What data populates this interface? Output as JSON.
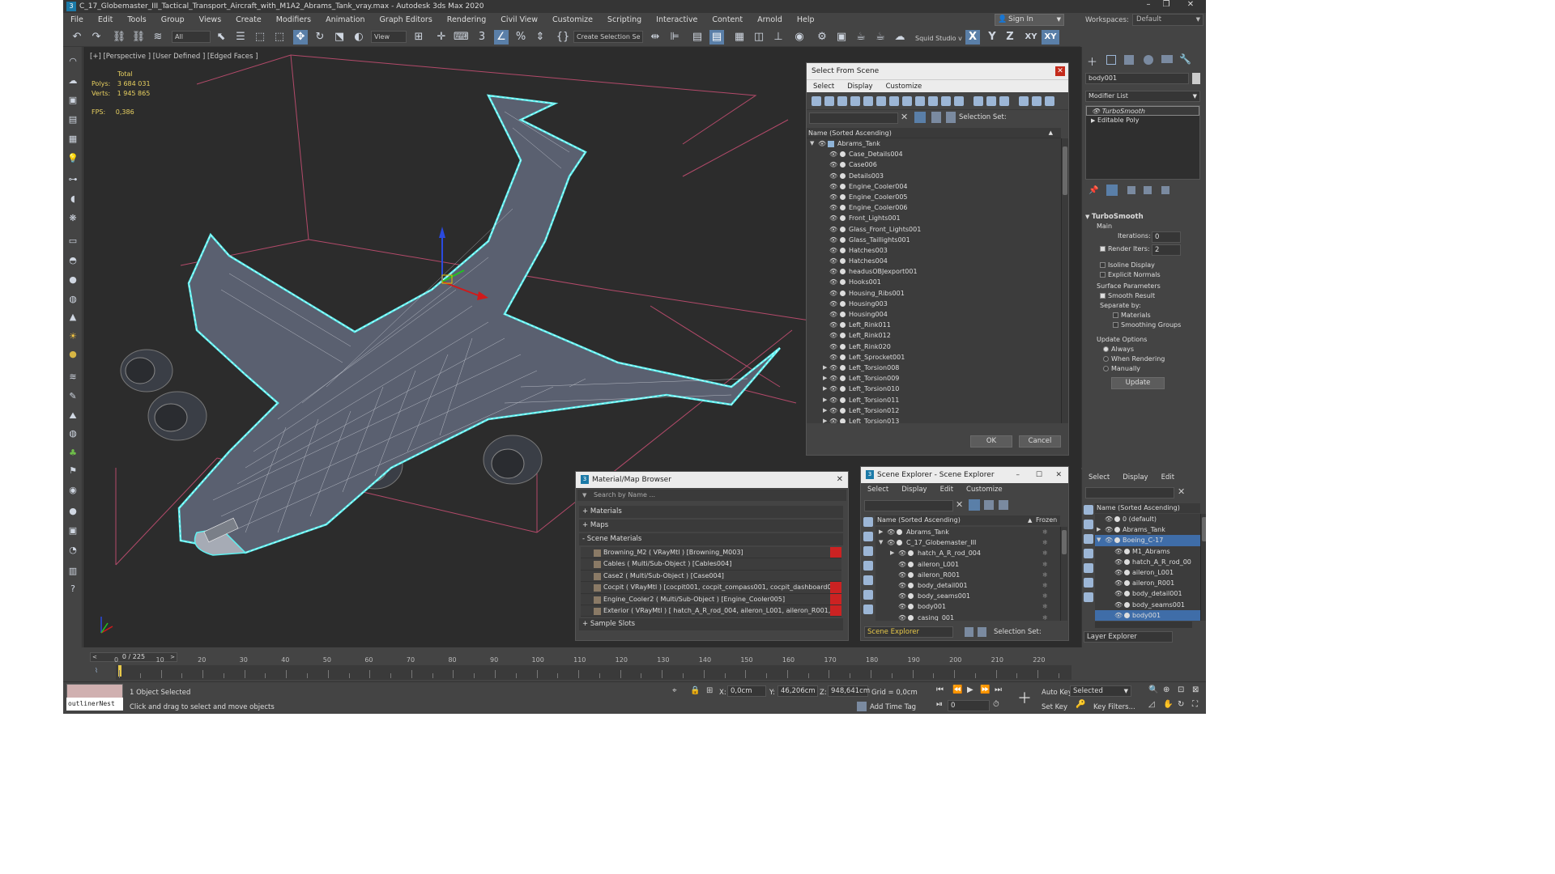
{
  "window": {
    "title": "C_17_Globemaster_III_Tactical_Transport_Aircraft_with_M1A2_Abrams_Tank_vray.max - Autodesk 3ds Max 2020",
    "controls": [
      "–",
      "❐",
      "✕"
    ]
  },
  "menu": [
    "File",
    "Edit",
    "Tools",
    "Group",
    "Views",
    "Create",
    "Modifiers",
    "Animation",
    "Graph Editors",
    "Rendering",
    "Civil View",
    "Customize",
    "Scripting",
    "Interactive",
    "Content",
    "Arnold",
    "Help"
  ],
  "account": {
    "sign_in": "Sign In",
    "workspaces_label": "Workspaces:",
    "workspace": "Default"
  },
  "toolbar": {
    "filter_select": "All",
    "ref_coord": "View",
    "selection_set": "Create Selection Se",
    "project": "Squid Studio v",
    "axes": [
      "X",
      "Y",
      "Z",
      "XY",
      "XY"
    ]
  },
  "viewport": {
    "label": "[+] [Perspective ] [User Defined ] [Edged Faces ]",
    "stats_total": "Total",
    "polys_label": "Polys:",
    "polys": "3 684 031",
    "verts_label": "Verts:",
    "verts": "1 945 865",
    "fps_label": "FPS:",
    "fps": "0,386"
  },
  "select_from_scene": {
    "title": "Select From Scene",
    "menu": [
      "Select",
      "Display",
      "Customize"
    ],
    "selection_set_label": "Selection Set:",
    "column_header": "Name (Sorted Ascending)",
    "root": "Abrams_Tank",
    "items": [
      {
        "name": "Case_Details004",
        "expand": false
      },
      {
        "name": "Case006",
        "expand": false
      },
      {
        "name": "Details003",
        "expand": false
      },
      {
        "name": "Engine_Cooler004",
        "expand": false
      },
      {
        "name": "Engine_Cooler005",
        "expand": false
      },
      {
        "name": "Engine_Cooler006",
        "expand": false
      },
      {
        "name": "Front_Lights001",
        "expand": false
      },
      {
        "name": "Glass_Front_Lights001",
        "expand": false
      },
      {
        "name": "Glass_Taillights001",
        "expand": false
      },
      {
        "name": "Hatches003",
        "expand": false
      },
      {
        "name": "Hatches004",
        "expand": false
      },
      {
        "name": "headusOBJexport001",
        "expand": false
      },
      {
        "name": "Hooks001",
        "expand": false
      },
      {
        "name": "Housing_Ribs001",
        "expand": false
      },
      {
        "name": "Housing003",
        "expand": false
      },
      {
        "name": "Housing004",
        "expand": false
      },
      {
        "name": "Left_Rink011",
        "expand": false
      },
      {
        "name": "Left_Rink012",
        "expand": false
      },
      {
        "name": "Left_Rink020",
        "expand": false
      },
      {
        "name": "Left_Sprocket001",
        "expand": false
      },
      {
        "name": "Left_Torsion008",
        "expand": true
      },
      {
        "name": "Left_Torsion009",
        "expand": true
      },
      {
        "name": "Left_Torsion010",
        "expand": true
      },
      {
        "name": "Left_Torsion011",
        "expand": true
      },
      {
        "name": "Left_Torsion012",
        "expand": true
      },
      {
        "name": "Left_Torsion013",
        "expand": true
      }
    ],
    "ok": "OK",
    "cancel": "Cancel"
  },
  "material_browser": {
    "title": "Material/Map Browser",
    "search_placeholder": "Search by Name ...",
    "materials": "+ Materials",
    "maps": "+ Maps",
    "scene_materials": "- Scene Materials",
    "entries": [
      "Browning_M2  ( VRayMtl ) [Browning_M003]",
      "Cables  ( Multi/Sub-Object ) [Cables004]",
      "Case2  ( Multi/Sub-Object ) [Case004]",
      "Cocpit  ( VRayMtl ) [cocpit001, cocpit_compass001, cocpit_dashboard001, co...",
      "Engine_Cooler2  ( Multi/Sub-Object ) [Engine_Cooler005]",
      "Exterior  ( VRayMtl ) [ hatch_A_R_rod_004, aileron_L001, aileron_R001, bod..."
    ],
    "sample_slots": "+ Sample Slots"
  },
  "scene_explorer": {
    "title": "Scene Explorer - Scene Explorer",
    "menu": [
      "Select",
      "Display",
      "Edit",
      "Customize"
    ],
    "col_name": "Name (Sorted Ascending)",
    "col_frozen": "Frozen",
    "items": [
      {
        "name": "Abrams_Tank",
        "level": 0,
        "arrow": "▶"
      },
      {
        "name": "C_17_Globemaster_III",
        "level": 0,
        "arrow": "▼"
      },
      {
        "name": "hatch_A_R_rod_004",
        "level": 1,
        "arrow": "▶"
      },
      {
        "name": "aileron_L001",
        "level": 1,
        "arrow": ""
      },
      {
        "name": "aileron_R001",
        "level": 1,
        "arrow": ""
      },
      {
        "name": "body_detail001",
        "level": 1,
        "arrow": ""
      },
      {
        "name": "body_seams001",
        "level": 1,
        "arrow": ""
      },
      {
        "name": "body001",
        "level": 1,
        "arrow": ""
      },
      {
        "name": "casing_001",
        "level": 1,
        "arrow": ""
      }
    ],
    "footer_name": "Scene Explorer",
    "selection_set_label": "Selection Set:"
  },
  "command_panel": {
    "object_name": "body001",
    "modifier_list": "Modifier List",
    "stack": [
      "TurboSmooth",
      "Editable Poly"
    ],
    "rollout_title": "TurboSmooth",
    "main": "Main",
    "iterations_label": "Iterations:",
    "iterations": "0",
    "render_iters_label": "Render Iters:",
    "render_iters": "2",
    "isoline": "Isoline Display",
    "explicit_normals": "Explicit Normals",
    "surface_params": "Surface Parameters",
    "smooth_result": "Smooth Result",
    "separate_by": "Separate by:",
    "materials": "Materials",
    "smoothing_groups": "Smoothing Groups",
    "update_options": "Update Options",
    "always": "Always",
    "when_rendering": "When Rendering",
    "manually": "Manually",
    "update": "Update"
  },
  "layer_explorer": {
    "menu": [
      "Select",
      "Display",
      "Edit"
    ],
    "col_name": "Name (Sorted Ascending)",
    "items": [
      {
        "name": "0 (default)",
        "level": 0,
        "arrow": "",
        "selected": false
      },
      {
        "name": "Abrams_Tank",
        "level": 0,
        "arrow": "▶",
        "selected": false
      },
      {
        "name": "Boeing_C-17",
        "level": 0,
        "arrow": "▼",
        "selected": true
      },
      {
        "name": "M1_Abrams",
        "level": 1,
        "arrow": "",
        "selected": false
      },
      {
        "name": "hatch_A_R_rod_00",
        "level": 1,
        "arrow": "",
        "selected": false
      },
      {
        "name": "aileron_L001",
        "level": 1,
        "arrow": "",
        "selected": false
      },
      {
        "name": "aileron_R001",
        "level": 1,
        "arrow": "",
        "selected": false
      },
      {
        "name": "body_detail001",
        "level": 1,
        "arrow": "",
        "selected": false
      },
      {
        "name": "body_seams001",
        "level": 1,
        "arrow": "",
        "selected": false
      },
      {
        "name": "body001",
        "level": 1,
        "arrow": "",
        "selected": true
      }
    ],
    "footer": "Layer Explorer"
  },
  "timeline": {
    "frame": "0 / 225",
    "ticks": [
      "0",
      "10",
      "20",
      "30",
      "40",
      "50",
      "60",
      "70",
      "80",
      "90",
      "100",
      "110",
      "120",
      "130",
      "140",
      "150",
      "160",
      "170",
      "180",
      "190",
      "200",
      "210",
      "220"
    ]
  },
  "status": {
    "maxscript": "outlinerNest",
    "selected": "1 Object Selected",
    "hint": "Click and drag to select and move objects",
    "x_label": "X:",
    "x": "0,0cm",
    "y_label": "Y:",
    "y": "46,206cm",
    "z_label": "Z:",
    "z": "948,641cm",
    "grid": "Grid = 0,0cm",
    "add_time_tag": "Add Time Tag",
    "auto_key": "Auto Key",
    "key_mode": "Selected",
    "set_key": "Set Key",
    "key_filters": "Key Filters...",
    "frame_field": "0"
  }
}
